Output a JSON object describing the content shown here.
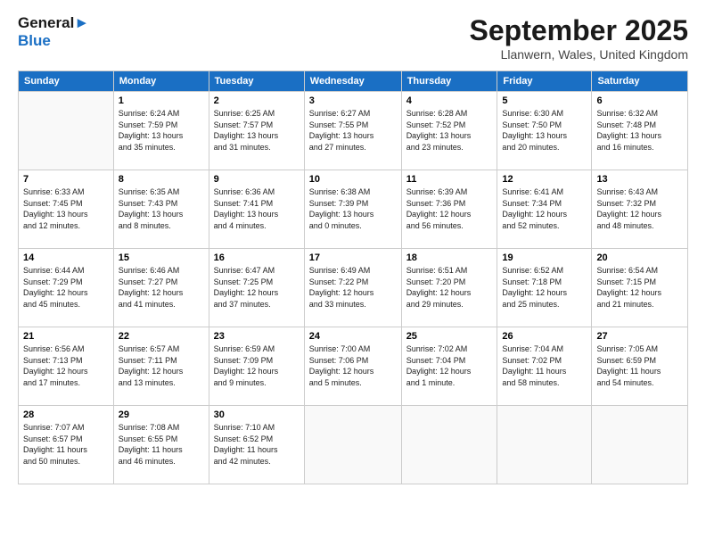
{
  "logo": {
    "line1": "General",
    "line2": "Blue"
  },
  "title": "September 2025",
  "location": "Llanwern, Wales, United Kingdom",
  "days_of_week": [
    "Sunday",
    "Monday",
    "Tuesday",
    "Wednesday",
    "Thursday",
    "Friday",
    "Saturday"
  ],
  "weeks": [
    [
      {
        "day": "",
        "info": ""
      },
      {
        "day": "1",
        "info": "Sunrise: 6:24 AM\nSunset: 7:59 PM\nDaylight: 13 hours\nand 35 minutes."
      },
      {
        "day": "2",
        "info": "Sunrise: 6:25 AM\nSunset: 7:57 PM\nDaylight: 13 hours\nand 31 minutes."
      },
      {
        "day": "3",
        "info": "Sunrise: 6:27 AM\nSunset: 7:55 PM\nDaylight: 13 hours\nand 27 minutes."
      },
      {
        "day": "4",
        "info": "Sunrise: 6:28 AM\nSunset: 7:52 PM\nDaylight: 13 hours\nand 23 minutes."
      },
      {
        "day": "5",
        "info": "Sunrise: 6:30 AM\nSunset: 7:50 PM\nDaylight: 13 hours\nand 20 minutes."
      },
      {
        "day": "6",
        "info": "Sunrise: 6:32 AM\nSunset: 7:48 PM\nDaylight: 13 hours\nand 16 minutes."
      }
    ],
    [
      {
        "day": "7",
        "info": "Sunrise: 6:33 AM\nSunset: 7:45 PM\nDaylight: 13 hours\nand 12 minutes."
      },
      {
        "day": "8",
        "info": "Sunrise: 6:35 AM\nSunset: 7:43 PM\nDaylight: 13 hours\nand 8 minutes."
      },
      {
        "day": "9",
        "info": "Sunrise: 6:36 AM\nSunset: 7:41 PM\nDaylight: 13 hours\nand 4 minutes."
      },
      {
        "day": "10",
        "info": "Sunrise: 6:38 AM\nSunset: 7:39 PM\nDaylight: 13 hours\nand 0 minutes."
      },
      {
        "day": "11",
        "info": "Sunrise: 6:39 AM\nSunset: 7:36 PM\nDaylight: 12 hours\nand 56 minutes."
      },
      {
        "day": "12",
        "info": "Sunrise: 6:41 AM\nSunset: 7:34 PM\nDaylight: 12 hours\nand 52 minutes."
      },
      {
        "day": "13",
        "info": "Sunrise: 6:43 AM\nSunset: 7:32 PM\nDaylight: 12 hours\nand 48 minutes."
      }
    ],
    [
      {
        "day": "14",
        "info": "Sunrise: 6:44 AM\nSunset: 7:29 PM\nDaylight: 12 hours\nand 45 minutes."
      },
      {
        "day": "15",
        "info": "Sunrise: 6:46 AM\nSunset: 7:27 PM\nDaylight: 12 hours\nand 41 minutes."
      },
      {
        "day": "16",
        "info": "Sunrise: 6:47 AM\nSunset: 7:25 PM\nDaylight: 12 hours\nand 37 minutes."
      },
      {
        "day": "17",
        "info": "Sunrise: 6:49 AM\nSunset: 7:22 PM\nDaylight: 12 hours\nand 33 minutes."
      },
      {
        "day": "18",
        "info": "Sunrise: 6:51 AM\nSunset: 7:20 PM\nDaylight: 12 hours\nand 29 minutes."
      },
      {
        "day": "19",
        "info": "Sunrise: 6:52 AM\nSunset: 7:18 PM\nDaylight: 12 hours\nand 25 minutes."
      },
      {
        "day": "20",
        "info": "Sunrise: 6:54 AM\nSunset: 7:15 PM\nDaylight: 12 hours\nand 21 minutes."
      }
    ],
    [
      {
        "day": "21",
        "info": "Sunrise: 6:56 AM\nSunset: 7:13 PM\nDaylight: 12 hours\nand 17 minutes."
      },
      {
        "day": "22",
        "info": "Sunrise: 6:57 AM\nSunset: 7:11 PM\nDaylight: 12 hours\nand 13 minutes."
      },
      {
        "day": "23",
        "info": "Sunrise: 6:59 AM\nSunset: 7:09 PM\nDaylight: 12 hours\nand 9 minutes."
      },
      {
        "day": "24",
        "info": "Sunrise: 7:00 AM\nSunset: 7:06 PM\nDaylight: 12 hours\nand 5 minutes."
      },
      {
        "day": "25",
        "info": "Sunrise: 7:02 AM\nSunset: 7:04 PM\nDaylight: 12 hours\nand 1 minute."
      },
      {
        "day": "26",
        "info": "Sunrise: 7:04 AM\nSunset: 7:02 PM\nDaylight: 11 hours\nand 58 minutes."
      },
      {
        "day": "27",
        "info": "Sunrise: 7:05 AM\nSunset: 6:59 PM\nDaylight: 11 hours\nand 54 minutes."
      }
    ],
    [
      {
        "day": "28",
        "info": "Sunrise: 7:07 AM\nSunset: 6:57 PM\nDaylight: 11 hours\nand 50 minutes."
      },
      {
        "day": "29",
        "info": "Sunrise: 7:08 AM\nSunset: 6:55 PM\nDaylight: 11 hours\nand 46 minutes."
      },
      {
        "day": "30",
        "info": "Sunrise: 7:10 AM\nSunset: 6:52 PM\nDaylight: 11 hours\nand 42 minutes."
      },
      {
        "day": "",
        "info": ""
      },
      {
        "day": "",
        "info": ""
      },
      {
        "day": "",
        "info": ""
      },
      {
        "day": "",
        "info": ""
      }
    ]
  ]
}
